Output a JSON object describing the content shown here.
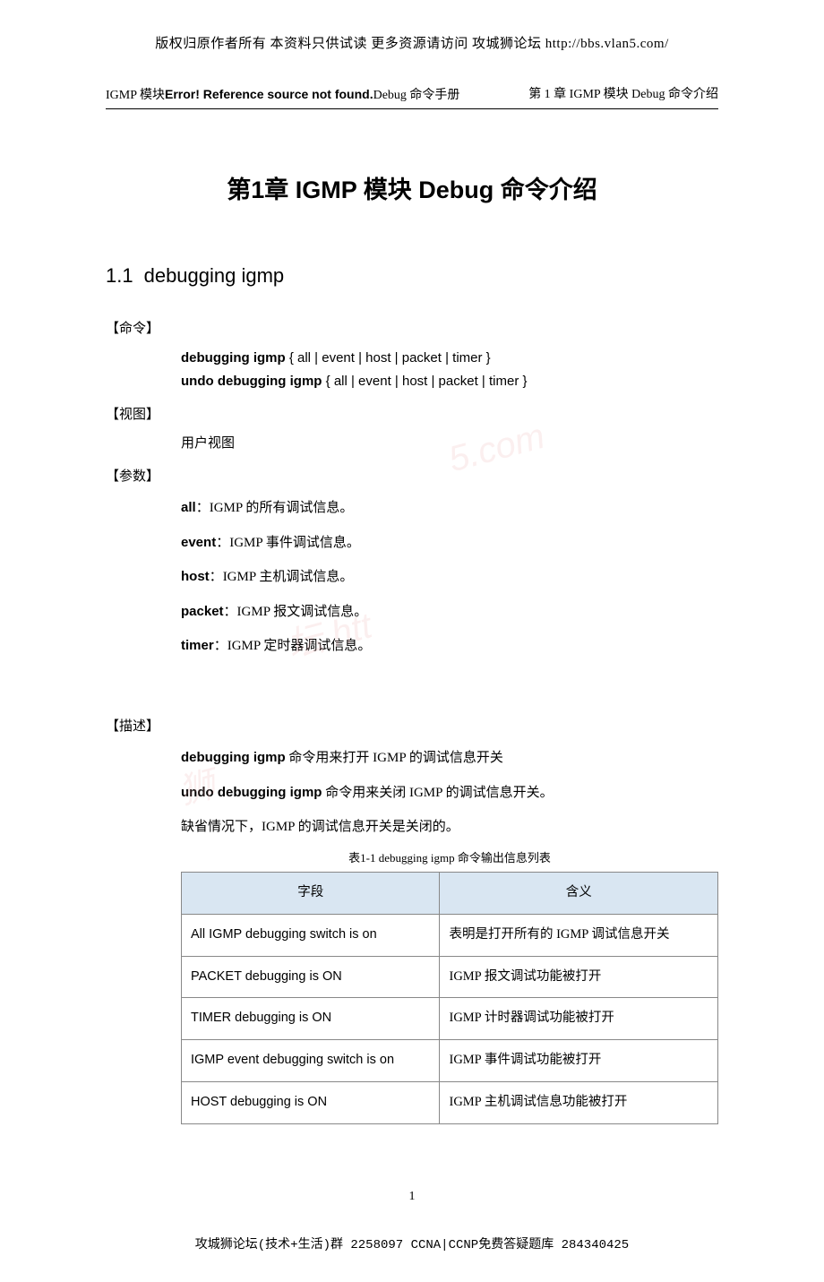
{
  "top_note": "版权归原作者所有 本资料只供试读 更多资源请访问 攻城狮论坛 http://bbs.vlan5.com/",
  "header": {
    "left_prefix": "IGMP 模块",
    "left_bold": "Error! Reference source not found.",
    "left_suffix": "Debug 命令手册",
    "right": "第 1 章  IGMP 模块 Debug 命令介绍"
  },
  "chapter_title": "第1章  IGMP 模块 Debug 命令介绍",
  "section": {
    "num": "1.1",
    "name": "debugging igmp"
  },
  "labels": {
    "cmd": "【命令】",
    "view": "【视图】",
    "param": "【参数】",
    "desc": "【描述】"
  },
  "syntax": {
    "line1_b": "debugging igmp",
    "line1_rest": " { all | event | host | packet | timer }",
    "line2_b": "undo debugging igmp",
    "line2_rest": " { all | event | host | packet | timer }"
  },
  "view_text": "用户视图",
  "params": [
    {
      "name": "all",
      "sep": "：",
      "text": "IGMP 的所有调试信息。"
    },
    {
      "name": "event",
      "sep": "：",
      "text": "IGMP 事件调试信息。"
    },
    {
      "name": "host",
      "sep": "：",
      "text": "IGMP 主机调试信息。"
    },
    {
      "name": "packet",
      "sep": "：",
      "text": "IGMP 报文调试信息。"
    },
    {
      "name": "timer",
      "sep": "：",
      "text": "IGMP 定时器调试信息。"
    }
  ],
  "desc": {
    "l1_b": "debugging igmp",
    "l1_rest": " 命令用来打开 IGMP 的调试信息开关",
    "l2_b": "undo debugging igmp",
    "l2_rest": " 命令用来关闭 IGMP 的调试信息开关。",
    "l3": "缺省情况下，IGMP 的调试信息开关是关闭的。"
  },
  "table": {
    "caption": "表1-1 debugging igmp 命令输出信息列表",
    "head": {
      "c1": "字段",
      "c2": "含义"
    },
    "rows": [
      {
        "c1": "All IGMP debugging switch is on",
        "c2": "表明是打开所有的 IGMP 调试信息开关"
      },
      {
        "c1": "PACKET debugging is ON",
        "c2": "IGMP 报文调试功能被打开"
      },
      {
        "c1": "TIMER debugging is ON",
        "c2": "IGMP 计时器调试功能被打开"
      },
      {
        "c1": "IGMP event debugging switch is on",
        "c2": "IGMP 事件调试功能被打开"
      },
      {
        "c1": "HOST debugging is ON",
        "c2": "IGMP 主机调试信息功能被打开"
      }
    ]
  },
  "page_num": "1",
  "footer": "攻城狮论坛(技术+生活)群 2258097 CCNA|CCNP免费答疑题库 284340425",
  "watermarks": {
    "w1": "5.com",
    "w2": "坛 htt",
    "w3": "狮"
  }
}
